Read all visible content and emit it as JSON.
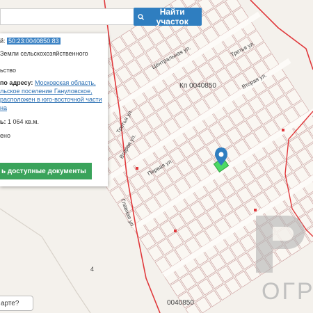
{
  "search": {
    "placeholder": "",
    "button_label": "Найти участок"
  },
  "info_card": {
    "cadastral_label": "й: ",
    "cadastral_number": "50:23:0040850:83",
    "category_line": "Земли сельскохозяйственного",
    "category_cont": "",
    "usage_line": "ьство",
    "address_label": "по адресу: ",
    "address_lines": [
      "Московская область,",
      "льское поселение Гануловское,",
      "расположен в юго-восточной части",
      "на"
    ],
    "area_label": "ь: ",
    "area_value": "1 064 кв.м.",
    "misc_line": "ено",
    "docs_button_label": "ь доступные документы"
  },
  "map": {
    "block_label_center": "Кп 0040850",
    "block_label_bottom": "0040850",
    "number_4": "4",
    "street_labels": [
      "Центральная ул.",
      "Третья ул.",
      "Вторая ул.",
      "Третья ул.",
      "Вторая ул.",
      "Первая ул.",
      "Главная ул."
    ],
    "selected_color": "#4cd964",
    "boundary_color": "#e0383b",
    "marker_color": "#2f7ec0"
  },
  "help": {
    "label": "арте?"
  },
  "watermark": {
    "text": "ОГР"
  }
}
